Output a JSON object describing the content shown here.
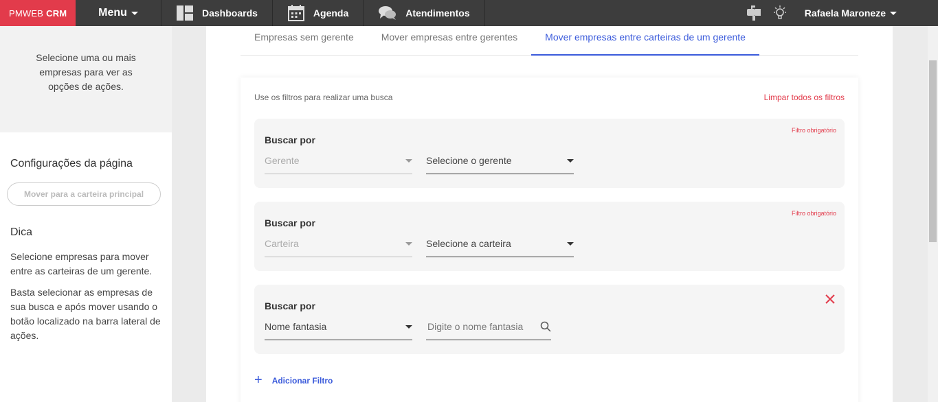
{
  "topbar": {
    "brand_prefix": "PMWEB",
    "brand_suffix": "CRM",
    "menu_label": "Menu",
    "nav": [
      {
        "label": "Dashboards",
        "icon": "dashboard-icon"
      },
      {
        "label": "Agenda",
        "icon": "calendar-icon"
      },
      {
        "label": "Atendimentos",
        "icon": "chat-icon"
      }
    ],
    "user_name": "Rafaela Maroneze",
    "colors": {
      "bar": "#3d3d3d",
      "brand": "#e23b4b"
    }
  },
  "sidebar": {
    "info": "Selecione uma ou mais empresas para ver as opções de ações.",
    "config_title": "Configurações da página",
    "move_button": "Mover para a carteira principal",
    "tip_title": "Dica",
    "tip_p1": "Selecione empresas para mover entre as carteiras de um gerente.",
    "tip_p2": "Basta selecionar as empresas de sua busca e após mover usando o botão localizado na barra lateral de ações."
  },
  "tabs": [
    {
      "label": "Empresas sem gerente",
      "active": false
    },
    {
      "label": "Mover empresas entre gerentes",
      "active": false
    },
    {
      "label": "Mover empresas entre carteiras de um gerente",
      "active": true
    }
  ],
  "filters": {
    "hint": "Use os filtros para realizar uma busca",
    "clear_all": "Limpar todos os filtros",
    "search_by": "Buscar por",
    "required": "Filtro obrigatório",
    "boxes": [
      {
        "field": "Gerente",
        "value": "Selecione o gerente"
      },
      {
        "field": "Carteira",
        "value": "Selecione a carteira"
      },
      {
        "field": "Nome fantasia",
        "placeholder": "Digite o nome fantasia"
      }
    ],
    "add_filter": "Adicionar Filtro"
  }
}
